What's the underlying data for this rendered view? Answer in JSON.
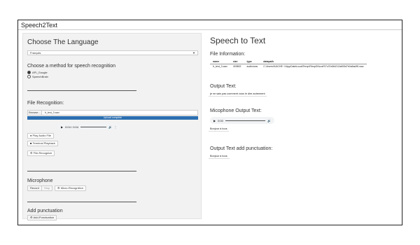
{
  "app": {
    "title": "Speech2Text"
  },
  "left": {
    "language_heading": "Choose The Language",
    "language_select": {
      "value": "Français"
    },
    "method_heading": "Choose a method for speech recognition",
    "methods": [
      "API_Google",
      "SpeechBrain"
    ],
    "file_recognition_heading": "File Recognition:",
    "browse_label": "Browse...",
    "file_name": "fr_test_3.wav",
    "upload_status": "Upload complete",
    "audio": {
      "time": "0:04 / 0:04"
    },
    "play_audio_label": "Play Audio File",
    "terminal_playback_label": "Terminal Playback",
    "file_recognize_label": "File-Recognize",
    "microphone_heading": "Microphone",
    "record_label": "Record",
    "stop_label": "Stop",
    "mic_recognize_label": "Micro-Recognition",
    "punctuation_heading": "Add punctuation",
    "add_punctuation_label": "Add-Punctuation"
  },
  "right": {
    "title": "Speech to Text",
    "file_info_heading": "File Information:",
    "table": {
      "headers": [
        "name",
        "size",
        "type",
        "datapath"
      ],
      "row": [
        "fr_test_3.wav",
        "403802",
        "audio/wav",
        "C:\\Users\\KAICHE~1\\AppData\\Local\\Temp\\RtmpGNcoxR\\7c37a3fd212a605d7b0a5ad90.wav"
      ]
    },
    "output_text_heading": "Output Text:",
    "output_text": "je ne sais pas comment vous le dire autrement",
    "mic_output_heading": "Micophone Output Text:",
    "mic_audio": {
      "time": "0:00"
    },
    "mic_output_text": "Bonjour à tous",
    "punct_output_heading": "Output Text add punctuation:",
    "punct_output_text": "Bonjour à tous."
  }
}
